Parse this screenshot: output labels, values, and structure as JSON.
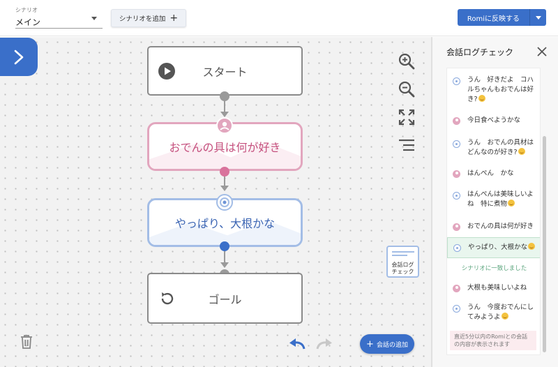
{
  "header": {
    "scenario_label": "シナリオ",
    "scenario_value": "メイン",
    "add_scenario_label": "シナリオを追加",
    "add_scenario_icon": "plus",
    "apply_label": "Romiに反映する"
  },
  "canvas": {
    "nodes": {
      "start": "スタート",
      "question": "おでんの具は何が好き",
      "answer": "やっぱり、大根かな",
      "goal": "ゴール"
    },
    "log_card_label_1": "会話ログ",
    "log_card_label_2": "チェック",
    "add_talk_label": "会話の追加"
  },
  "panel": {
    "title": "会話ログチェック",
    "items": [
      {
        "speaker": "romi",
        "text": "うん　好きだよ　コハルちゃんもおでんは好き?"
      },
      {
        "speaker": "user",
        "text": "今日食べようかな"
      },
      {
        "speaker": "romi",
        "text": "うん　おでんの具材はどんなのが好き?"
      },
      {
        "speaker": "user",
        "text": "はんぺん　かな"
      },
      {
        "speaker": "romi",
        "text": "はんぺんは美味しいよね　特に煮物"
      },
      {
        "speaker": "user",
        "text": "おでんの具は何が好き"
      },
      {
        "speaker": "romi",
        "text": "やっぱり、大根かな"
      },
      {
        "speaker": "user",
        "text": "大根も美味しいよね"
      },
      {
        "speaker": "romi",
        "text": "うん　今度おでんにしてみようよ"
      }
    ],
    "match_text": "シナリオに一致しました",
    "footer_note": "直近5分以内のRomiとの会話の内容が表示されます"
  },
  "colors": {
    "primary": "#3a6fc9",
    "pink": "#e2a6be",
    "blue": "#a3bde6",
    "gray": "#8a8a8a",
    "match": "#5aa47c"
  }
}
